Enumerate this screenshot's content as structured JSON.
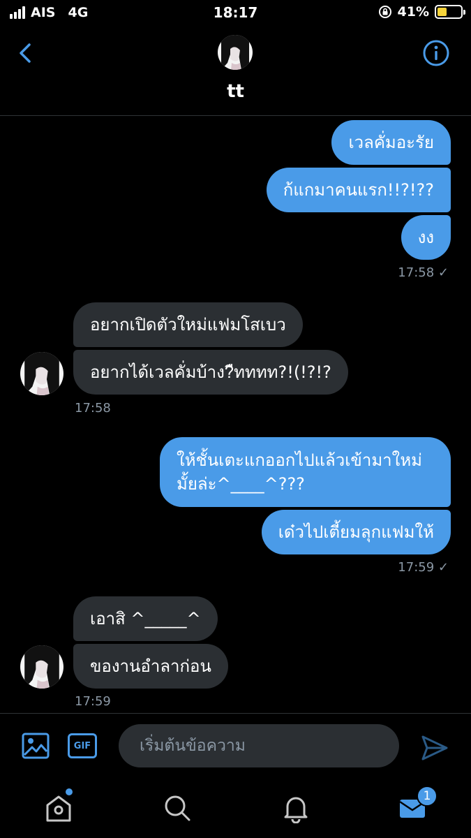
{
  "status_bar": {
    "carrier": "AIS",
    "network": "4G",
    "time": "18:17",
    "battery": "41%",
    "battery_level": 0.41
  },
  "header": {
    "name": "tt"
  },
  "messages": [
    {
      "side": "sent",
      "text": "เวลคั่มอะรัย"
    },
    {
      "side": "sent",
      "text": "ก้แกมาคนแรก!!?!??"
    },
    {
      "side": "sent",
      "text": "งง"
    },
    {
      "side": "sent-time",
      "text": "17:58"
    },
    {
      "side": "recv",
      "text": "อยากเปิดตัวใหม่แฟมโสเบว"
    },
    {
      "side": "recv",
      "text": "อยากได้เวลคั่มบ้าง?ืทททท?!(!?!?"
    },
    {
      "side": "recv-time",
      "text": "17:58"
    },
    {
      "side": "sent",
      "text": "ให้ชั้นเตะแกออกไปแล้วเข้ามาใหม่"
    },
    {
      "side": "sent",
      "text": "มั้ยล่ะ^____^???"
    },
    {
      "side": "sent",
      "text": "เด๋วไปเตี้ยมลุกแฟมให้"
    },
    {
      "side": "sent-time",
      "text": "17:59"
    },
    {
      "side": "recv",
      "text": "เอาสิ ^_____^"
    },
    {
      "side": "recv",
      "text": "ของานอำลาก่อน"
    },
    {
      "side": "recv-time",
      "text": "17:59"
    }
  ],
  "composer": {
    "placeholder": "เริ่มต้นข้อความ",
    "gif_label": "GIF"
  },
  "tabbar": {
    "messages_badge": "1"
  },
  "colors": {
    "accent": "#4a9be8",
    "received_bubble": "#2b2f33",
    "background": "#000000"
  }
}
